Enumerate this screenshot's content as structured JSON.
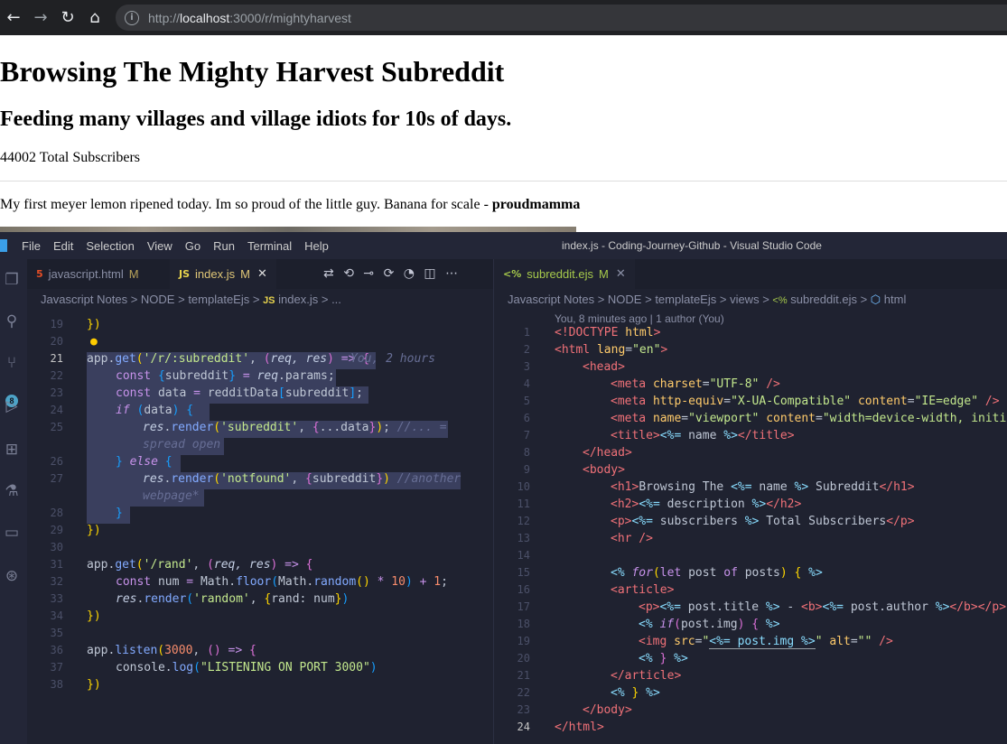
{
  "browser": {
    "url_scheme": "http://",
    "url_host": "localhost",
    "url_path": ":3000/r/mightyharvest"
  },
  "page": {
    "title": "Browsing The Mighty Harvest Subreddit",
    "description": "Feeding many villages and village idiots for 10s of days.",
    "subscribers": "44002 Total Subscribers",
    "post_title": "My first meyer lemon ripened today. Im so proud of the little guy. Banana for scale",
    "post_sep": " - ",
    "post_author": "proudmamma"
  },
  "vscode": {
    "window_title": "index.js - Coding-Journey-Github - Visual Studio Code",
    "menu": [
      "File",
      "Edit",
      "Selection",
      "View",
      "Go",
      "Run",
      "Terminal",
      "Help"
    ],
    "badge": "8",
    "left_tabs": [
      {
        "label": "javascript.html",
        "status": "M"
      },
      {
        "label": "index.js",
        "status": "M"
      }
    ],
    "right_tab": {
      "label": "subreddit.ejs",
      "status": "M"
    },
    "left_breadcrumb": [
      "Javascript Notes",
      "NODE",
      "templateEjs",
      "index.js",
      "..."
    ],
    "right_breadcrumb": [
      "Javascript Notes",
      "NODE",
      "templateEjs",
      "views",
      "subreddit.ejs",
      "html"
    ],
    "right_blame": "You, 8 minutes ago | 1 author (You)",
    "inline_blame": "You, 2 hours",
    "left_line_numbers": [
      "19",
      "20",
      "21",
      "22",
      "23",
      "24",
      "25",
      "",
      "26",
      "27",
      "",
      "28",
      "29",
      "30",
      "31",
      "32",
      "33",
      "34",
      "35",
      "36",
      "37",
      "38"
    ],
    "right_line_numbers": [
      "1",
      "2",
      "3",
      "4",
      "5",
      "6",
      "7",
      "8",
      "9",
      "10",
      "11",
      "12",
      "13",
      "14",
      "15",
      "16",
      "17",
      "18",
      "19",
      "20",
      "21",
      "22",
      "23",
      "24"
    ],
    "current_line_left": "21",
    "current_line_right": "24"
  }
}
